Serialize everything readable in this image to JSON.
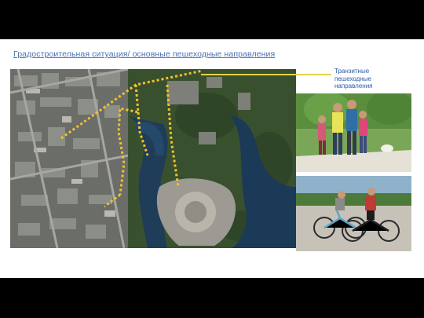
{
  "slide": {
    "title": "Градостроительная ситуация/ основные пешеходные направления",
    "legend": {
      "label": "Транзитные пешеходные направления",
      "line_color": "#e2d24a"
    },
    "map": {
      "route_color": "#f2c12e"
    },
    "photos": [
      {
        "name": "family-walking-photo"
      },
      {
        "name": "cyclists-photo"
      }
    ]
  }
}
